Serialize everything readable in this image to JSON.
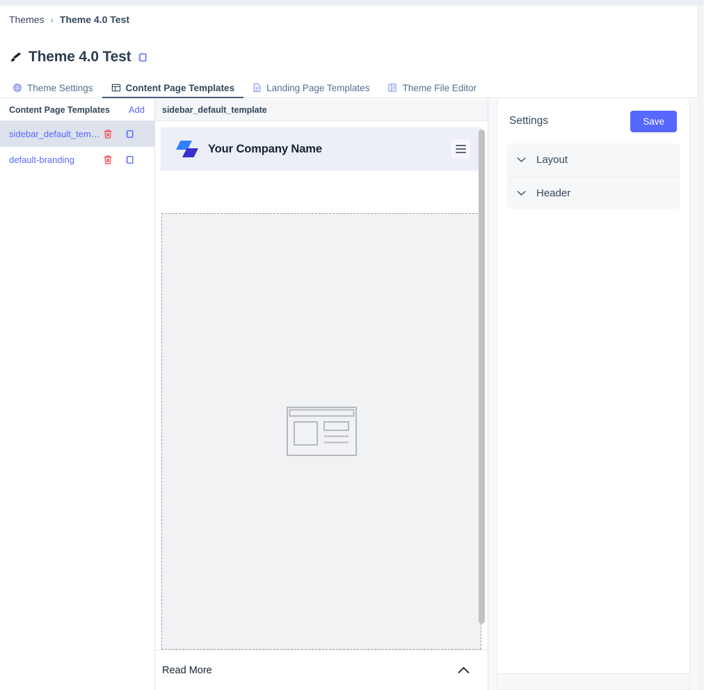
{
  "breadcrumb": {
    "parent": "Themes",
    "separator": "›",
    "current": "Theme 4.0 Test"
  },
  "header": {
    "title": "Theme 4.0 Test",
    "brush_icon": "paintbrush-icon",
    "copy_icon": "copy-icon"
  },
  "tabs": [
    {
      "label": "Theme Settings",
      "icon": "globe-icon",
      "active": false
    },
    {
      "label": "Content Page Templates",
      "icon": "layout-template-icon",
      "active": true
    },
    {
      "label": "Landing Page Templates",
      "icon": "document-icon",
      "active": false
    },
    {
      "label": "Theme File Editor",
      "icon": "file-code-icon",
      "active": false
    }
  ],
  "left_panel": {
    "heading": "Content Page Templates",
    "add_label": "Add",
    "templates": [
      {
        "name": "sidebar_default_template",
        "selected": true,
        "delete_icon": "trash-icon",
        "clone_icon": "copy-icon"
      },
      {
        "name": "default-branding",
        "selected": false,
        "delete_icon": "trash-icon",
        "clone_icon": "copy-icon"
      }
    ]
  },
  "preview": {
    "title": "sidebar_default_template",
    "company_name": "Your Company Name",
    "logo_icon": "company-logo-icon",
    "menu_icon": "hamburger-menu-icon",
    "body_placeholder_icon": "page-layout-placeholder-icon",
    "read_more_label": "Read More",
    "read_more_chevron": "chevron-up-icon"
  },
  "settings": {
    "title": "Settings",
    "save_label": "Save",
    "items": [
      {
        "label": "Layout",
        "chevron": "chevron-down-icon"
      },
      {
        "label": "Header",
        "chevron": "chevron-down-icon"
      }
    ]
  },
  "colors": {
    "accent": "#5768ff",
    "active_tab_underline": "#425b76",
    "selected_row_bg": "#dde2ec",
    "preview_header_bg": "#eceef8",
    "logo_light_blue": "#2f80ff",
    "logo_dark_blue": "#3730cf",
    "trash_red": "#f2545b",
    "text_primary": "#33475b"
  }
}
